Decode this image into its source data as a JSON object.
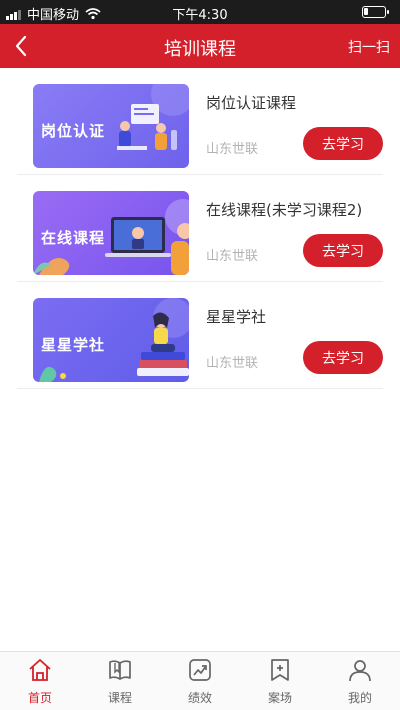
{
  "status_bar": {
    "carrier": "中国移动",
    "time": "下午4:30",
    "battery_level": 0.2
  },
  "nav": {
    "title": "培训课程",
    "scan_label": "扫一扫"
  },
  "courses": [
    {
      "title": "岗位认证课程",
      "provider": "山东世联",
      "button": "去学习",
      "thumb_label": "岗位认证",
      "thumb_color": "#7b6df0"
    },
    {
      "title": "在线课程(未学习课程2)",
      "provider": "山东世联",
      "button": "去学习",
      "thumb_label": "在线课程",
      "thumb_color": "#8a5ff2"
    },
    {
      "title": "星星学社",
      "provider": "山东世联",
      "button": "去学习",
      "thumb_label": "星星学社",
      "thumb_color": "#6b5ef0"
    }
  ],
  "tabbar": {
    "items": [
      {
        "label": "首页",
        "icon": "home-icon",
        "active": true
      },
      {
        "label": "课程",
        "icon": "book-icon",
        "active": false
      },
      {
        "label": "绩效",
        "icon": "chart-icon",
        "active": false
      },
      {
        "label": "案场",
        "icon": "bookmark-icon",
        "active": false
      },
      {
        "label": "我的",
        "icon": "user-icon",
        "active": false
      }
    ]
  },
  "colors": {
    "brand_red": "#d4202a",
    "status_bar": "#1c1c1c"
  }
}
